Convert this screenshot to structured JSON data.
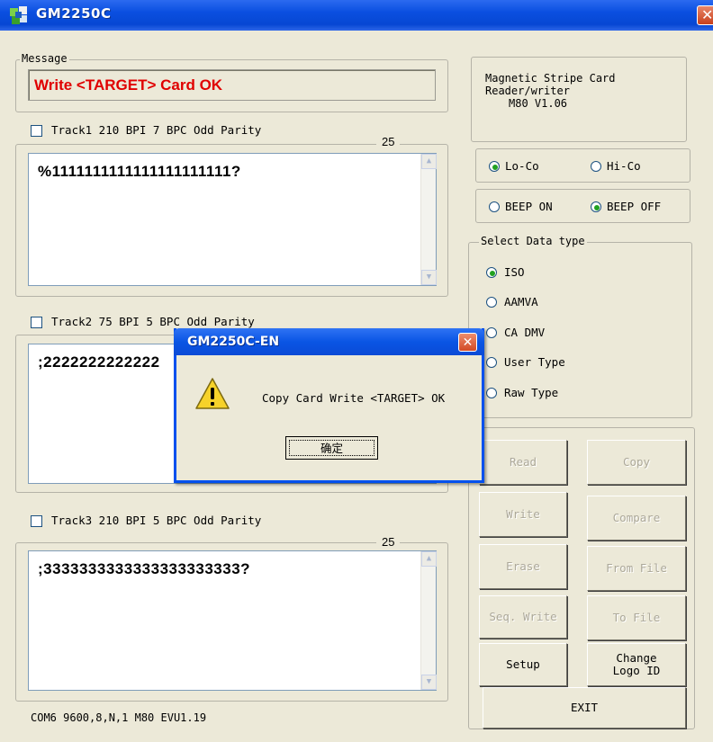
{
  "window": {
    "title": "GM2250C",
    "icon": "app-icon",
    "close_icon": "close-icon"
  },
  "message": {
    "legend": "Message",
    "text": "Write <TARGET> Card OK",
    "text_color": "#e00000"
  },
  "tracks": [
    {
      "label": "Track1 210 BPI 7 BPC Odd Parity",
      "checked": false,
      "count": "25",
      "data": "%1111111111111111111111?"
    },
    {
      "label": "Track2 75 BPI 5 BPC Odd Parity",
      "checked": false,
      "count": "",
      "data": ";2222222222222"
    },
    {
      "label": "Track3 210 BPI 5 BPC Odd Parity",
      "checked": false,
      "count": "25",
      "data": ";3333333333333333333333?"
    }
  ],
  "info": {
    "line1": "Magnetic Stripe Card",
    "line2": "Reader/writer",
    "line3": "M80  V1.06"
  },
  "coercivity": {
    "options": [
      "Lo-Co",
      "Hi-Co"
    ],
    "selected": "Lo-Co"
  },
  "beep": {
    "options": [
      "BEEP ON",
      "BEEP OFF"
    ],
    "selected": "BEEP OFF"
  },
  "data_type": {
    "legend": "Select Data type",
    "options": [
      "ISO",
      "AAMVA",
      "CA DMV",
      "User Type",
      "Raw Type"
    ],
    "selected": "ISO"
  },
  "buttons": {
    "read": "Read",
    "copy": "Copy",
    "write": "Write",
    "compare": "Compare",
    "erase": "Erase",
    "from_file": "From File",
    "seq_write": "Seq. Write",
    "to_file": "To File",
    "setup": "Setup",
    "change_logo_1": "Change",
    "change_logo_2": "Logo ID",
    "exit": "EXIT"
  },
  "status": "COM6 9600,8,N,1  M80 EVU1.19",
  "dialog": {
    "title": "GM2250C-EN",
    "message": "Copy Card Write <TARGET> OK",
    "ok": "确定",
    "icon": "warning-icon",
    "close_icon": "close-icon"
  },
  "colors": {
    "titlebar": "#0a4fe0",
    "face": "#ece9d8",
    "error_text": "#e00000"
  }
}
